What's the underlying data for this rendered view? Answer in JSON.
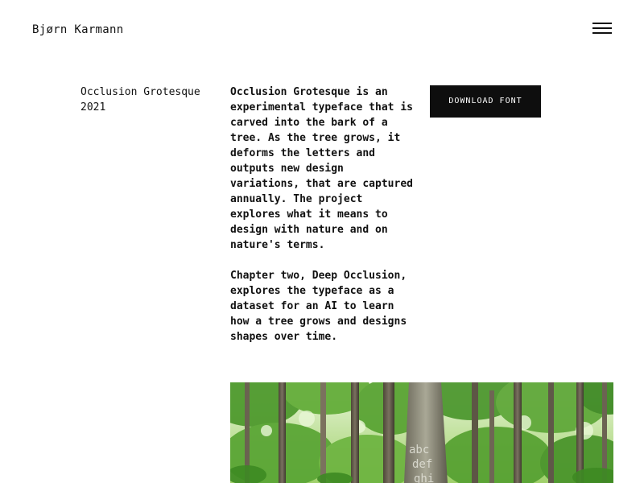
{
  "header": {
    "site_title": "Bjørn Karmann",
    "menu_icon": "hamburger-menu-icon"
  },
  "project": {
    "name": "Occlusion Grotesque",
    "year": "2021"
  },
  "description": {
    "paragraphs": [
      "Occlusion Grotesque is an experimental typeface that is carved into the bark of a tree. As the tree grows, it deforms the letters and outputs new design variations, that are captured annually. The project explores what it means to design with nature and on nature's terms.",
      "Chapter two, Deep Occlusion, explores the typeface as a dataset for an AI to learn how a tree grows and designs shapes over time."
    ]
  },
  "actions": {
    "download_label": "DOWNLOAD FONT"
  },
  "hero_image": {
    "carved_lines": [
      "abc",
      "def",
      "ghi"
    ]
  },
  "colors": {
    "background": "#ffffff",
    "text": "#111111",
    "button_bg": "#0e0e0e",
    "button_text": "#ffffff",
    "foliage": "#6fae48"
  }
}
